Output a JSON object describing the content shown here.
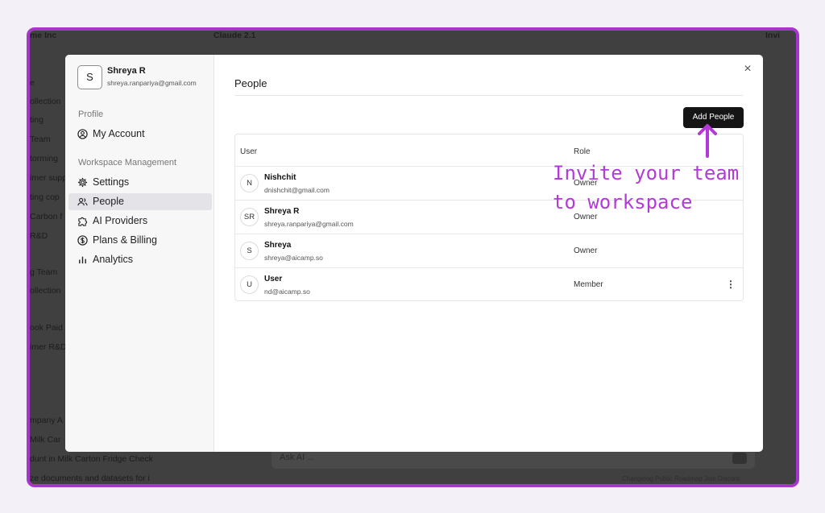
{
  "background_app": {
    "topbar": [
      "me Inc",
      "Claude 2.1",
      "Invi"
    ],
    "sidebar_fragments": [
      "e",
      "ollection",
      "ting",
      "Team",
      "torming",
      "imer supp",
      "ting cop",
      "Carbon f",
      "R&D",
      "g Team",
      "ollection",
      "ook Paid",
      "imer R&D",
      "mpany A",
      "Milk Car",
      "dunt in Milk Carton Fridge Check",
      "ze documents and datasets for i"
    ],
    "ask_placeholder": "Ask AI ...",
    "footer": "Changelog   Public Roadmap   Join Discord"
  },
  "modal": {
    "profile": {
      "initial": "S",
      "name": "Shreya R",
      "email": "shreya.ranpariya@gmail.com"
    },
    "sections": {
      "profile_label": "Profile",
      "workspace_label": "Workspace Management"
    },
    "nav": {
      "my_account": "My Account",
      "settings": "Settings",
      "people": "People",
      "ai_providers": "AI Providers",
      "plans_billing": "Plans & Billing",
      "analytics": "Analytics"
    },
    "active_nav": "People",
    "page_title": "People",
    "close_icon": "×",
    "add_button": "Add People",
    "table": {
      "headers": {
        "user": "User",
        "role": "Role"
      },
      "rows": [
        {
          "initials": "N",
          "name": "Nishchit",
          "email": "dnishchit@gmail.com",
          "role": "Owner"
        },
        {
          "initials": "SR",
          "name": "Shreya R",
          "email": "shreya.ranpariya@gmail.com",
          "role": "Owner"
        },
        {
          "initials": "S",
          "name": "Shreya",
          "email": "shreya@aicamp.so",
          "role": "Owner"
        },
        {
          "initials": "U",
          "name": "User",
          "email": "nd@aicamp.so",
          "role": "Member"
        }
      ]
    }
  },
  "annotation": {
    "line1": "Invite your team",
    "line2": "to workspace",
    "color": "#b23ad6"
  },
  "colors": {
    "frame": "#a636c9",
    "button_bg": "#151515",
    "active_nav_bg": "#e4e3e8"
  }
}
